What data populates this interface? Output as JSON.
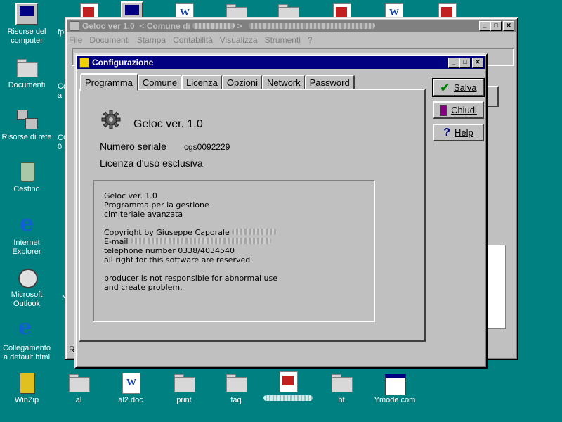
{
  "desktop_icons": [
    {
      "name": "my-computer-icon",
      "label": "Risorse del\ncomputer"
    },
    {
      "name": "documents-icon",
      "label": "Documenti"
    },
    {
      "name": "network-icon",
      "label": "Risorse di rete"
    },
    {
      "name": "recycle-bin-icon",
      "label": "Cestino"
    },
    {
      "name": "internet-explorer-icon",
      "label": "Internet\nExplorer"
    },
    {
      "name": "outlook-icon",
      "label": "Microsoft\nOutlook"
    },
    {
      "name": "shortcut-icon",
      "label": "Collegamento\na default.html"
    },
    {
      "name": "winzip-icon",
      "label": "WinZip"
    }
  ],
  "bottom_icons": [
    {
      "name": "folder-icon",
      "label": "al"
    },
    {
      "name": "word-doc-icon",
      "label": "al2.doc"
    },
    {
      "name": "folder-icon",
      "label": "print"
    },
    {
      "name": "folder-icon",
      "label": "faq"
    },
    {
      "name": "stamp-icon",
      "label": ""
    },
    {
      "name": "folder-icon",
      "label": "ht"
    },
    {
      "name": "exe-icon",
      "label": "Ymode.com"
    }
  ],
  "side_partial_labels": [
    "fp",
    "Co\na F",
    "CO\n0 S",
    "N",
    "M"
  ],
  "main_window": {
    "title_app": "Geloc ver 1.0",
    "title_comune": "< Comune di",
    "title_end": ">",
    "menu": [
      "File",
      "Documenti",
      "Stampa",
      "Contabilità",
      "Visualizza",
      "Strumenti",
      "?"
    ],
    "status_fragment": "R"
  },
  "dialog": {
    "title": "Configurazione",
    "tabs": [
      "Programma",
      "Comune",
      "Licenza",
      "Opzioni",
      "Network",
      "Password"
    ],
    "selected_tab": 0,
    "buttons": {
      "save": "Salva",
      "close": "Chiudi",
      "help": "Help"
    },
    "program": {
      "name": "Geloc ver. 1.0",
      "serial_label": "Numero seriale",
      "serial_value": "cgs0092229",
      "license": "Licenza d'uso esclusiva"
    },
    "info_lines": [
      "Geloc ver. 1.0",
      "Programma per la gestione",
      "cimiteriale avanzata",
      "",
      "Copyright by Giuseppe Caporale",
      "E-mail",
      "telephone number 0338/4034540",
      "all right for this software are reserved",
      "",
      "producer is not responsible for abnormal use",
      "and create problem."
    ]
  },
  "colors": {
    "desktop": "#008080",
    "titlebar_active": "#000080",
    "titlebar_inactive": "#808080",
    "face": "#c0c0c0"
  }
}
